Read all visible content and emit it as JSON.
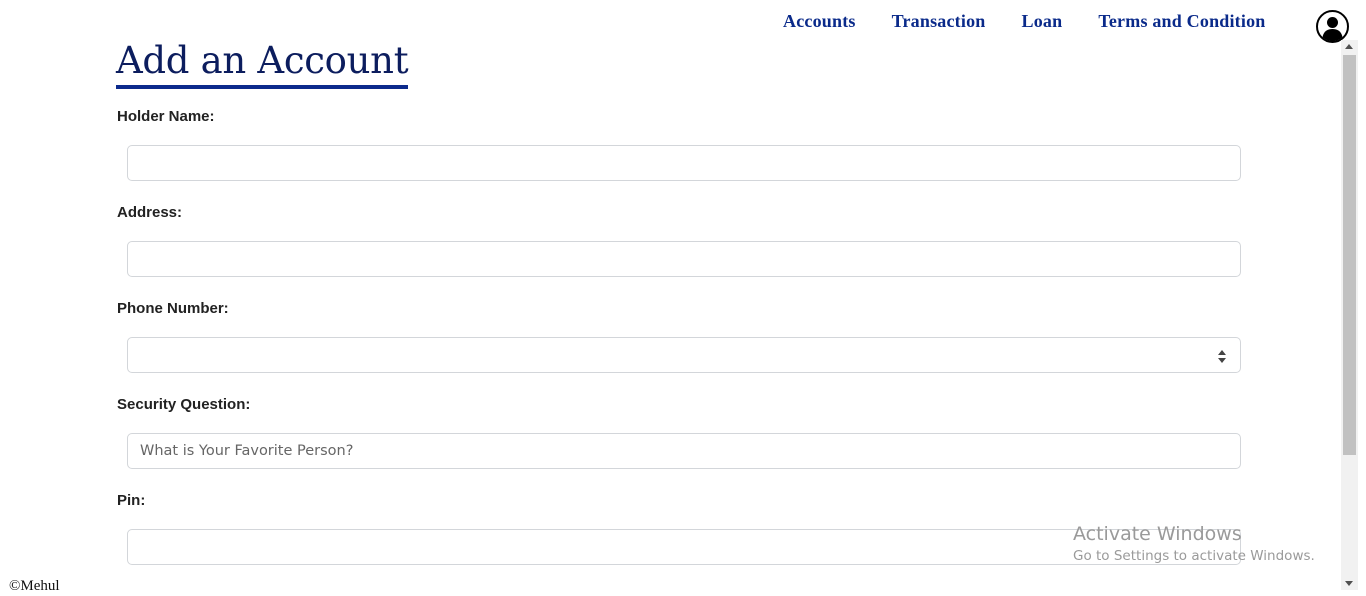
{
  "nav": {
    "items": [
      "Accounts",
      "Transaction",
      "Loan",
      "Terms and Condition"
    ]
  },
  "header": {
    "avatar_icon": "user-circle-icon"
  },
  "page": {
    "title": "Add an Account"
  },
  "form": {
    "holder_name": {
      "label": "Holder Name:",
      "value": ""
    },
    "address": {
      "label": "Address:",
      "value": ""
    },
    "phone": {
      "label": "Phone Number:",
      "value": ""
    },
    "security": {
      "label": "Security Question:",
      "placeholder": "What is Your Favorite Person?"
    },
    "pin": {
      "label": "Pin:",
      "value": ""
    }
  },
  "watermark": {
    "title": "Activate Windows",
    "subtitle": "Go to Settings to activate Windows."
  },
  "footer": {
    "text": "©Mehul"
  },
  "colors": {
    "nav": "#0a2a8a",
    "title": "#0c1d5e",
    "title_underline": "#0c2a8c"
  }
}
